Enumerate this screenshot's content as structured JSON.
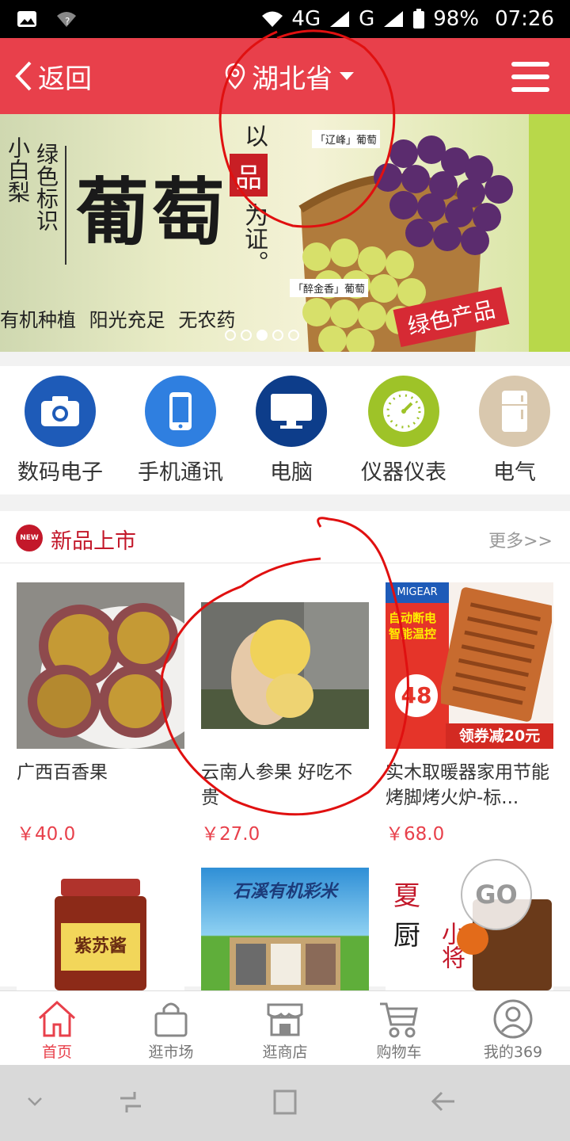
{
  "status_bar": {
    "network": "4G",
    "network2": "G",
    "battery": "98%",
    "time": "07:26"
  },
  "header": {
    "back_label": "返回",
    "region": "湖北省"
  },
  "banner": {
    "left_vertical_1": "小白梨",
    "left_vertical_2": "绿色标识",
    "headline": "葡萄",
    "tagline": "有机种植  阳光充足  无农药",
    "seal_char": "品",
    "side_text_top": "以",
    "side_text_bottom": "为证。",
    "label_1": "「辽峰」葡萄",
    "label_2": "「醉金香」葡萄",
    "ribbon": "绿色产品",
    "dot_count": 5,
    "active_dot": 2
  },
  "categories": [
    {
      "label": "数码电子",
      "icon": "camera-icon",
      "color": "#1e5bb8"
    },
    {
      "label": "手机通讯",
      "icon": "phone-icon",
      "color": "#2f7fe0"
    },
    {
      "label": "电脑",
      "icon": "monitor-icon",
      "color": "#0d3d8a"
    },
    {
      "label": "仪器仪表",
      "icon": "clock-icon",
      "color": "#9ec328"
    },
    {
      "label": "电气",
      "icon": "fridge-icon",
      "color": "#d9c8ae"
    }
  ],
  "new_products": {
    "badge": "NEW",
    "title": "新品上市",
    "more": "更多>>",
    "items": [
      {
        "title": "广西百香果",
        "price": "￥40.0"
      },
      {
        "title": "云南人参果 好吃不贵",
        "price": "￥27.0"
      },
      {
        "title": "实木取暖器家用节能烤脚烤火炉-标...",
        "price": "￥68.0"
      }
    ],
    "img_text": {
      "heater_brand": "MIGEAR",
      "heater_red": "自动断电",
      "heater_red2": "智能温控",
      "heater_coupon": "领券减20元",
      "heater_num": "48",
      "rice": "石溪有机彩米",
      "sauce": "紫苏酱",
      "chef_1": "夏",
      "chef_2": "厨",
      "chef_3": "小将"
    }
  },
  "go_button": "GO",
  "tabs": [
    {
      "label": "首页",
      "icon": "home-icon"
    },
    {
      "label": "逛市场",
      "icon": "bag-icon"
    },
    {
      "label": "逛商店",
      "icon": "store-icon"
    },
    {
      "label": "购物车",
      "icon": "cart-icon"
    },
    {
      "label": "我的369",
      "icon": "user-icon"
    }
  ],
  "colors": {
    "brand": "#e8404b",
    "section_title": "#c3182a",
    "annotation": "#e01010"
  }
}
